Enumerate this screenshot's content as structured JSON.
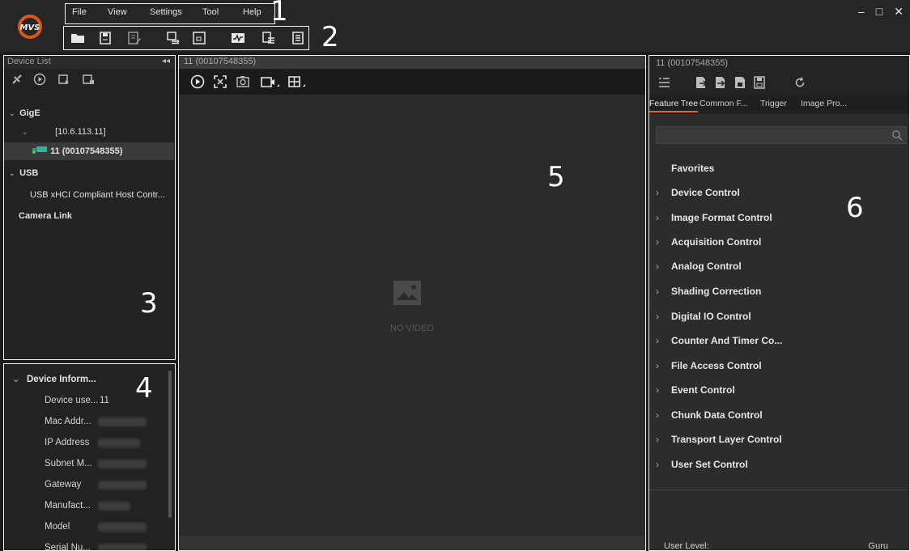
{
  "menu": [
    "File",
    "View",
    "Settings",
    "Tool",
    "Help"
  ],
  "window_controls": {
    "minimize": "–",
    "maximize": "□",
    "close": "✕"
  },
  "annotations": [
    "1",
    "2",
    "3",
    "4",
    "5",
    "6"
  ],
  "device_list": {
    "title": "Device List",
    "collapse": "◂◂",
    "tree": [
      {
        "label": "GigE",
        "level": 0,
        "bold": true,
        "expanded": true
      },
      {
        "label": "[10.6.113.11]",
        "level": 1,
        "bold": false,
        "expanded": true
      },
      {
        "label": "11 (00107548355)",
        "level": 2,
        "bold": true,
        "selected": true
      },
      {
        "label": "USB",
        "level": 0,
        "bold": true,
        "expanded": true
      },
      {
        "label": "USB xHCI Compliant Host Contr...",
        "level": 1,
        "bold": false
      },
      {
        "label": "Camera Link",
        "level": 0,
        "bold": true
      }
    ]
  },
  "device_info": {
    "section": "Device Inform...",
    "rows": [
      {
        "key": "Device use...",
        "value": "11"
      },
      {
        "key": "Mac Addr...",
        "value": ""
      },
      {
        "key": "IP Address",
        "value": ""
      },
      {
        "key": "Subnet M...",
        "value": ""
      },
      {
        "key": "Gateway",
        "value": ""
      },
      {
        "key": "Manufact...",
        "value": ""
      },
      {
        "key": "Model",
        "value": ""
      },
      {
        "key": "Serial Nu...",
        "value": ""
      }
    ]
  },
  "video": {
    "title": "11 (00107548355)",
    "no_video": "NO VIDEO"
  },
  "feature": {
    "title": "11 (00107548355)",
    "tabs": [
      "Feature Tree",
      "Common F...",
      "Trigger",
      "Image Pro..."
    ],
    "search_placeholder": "",
    "favorites": "Favorites",
    "items": [
      "Device Control",
      "Image Format Control",
      "Acquisition Control",
      "Analog Control",
      "Shading Correction",
      "Digital IO Control",
      "Counter And Timer Co...",
      "File Access Control",
      "Event Control",
      "Chunk Data Control",
      "Transport Layer Control",
      "User Set Control"
    ],
    "user_level_label": "User Level:",
    "user_level_value": "Guru"
  },
  "colors": {
    "accent": "#e0651a",
    "camera_icon": "#2fb5a0",
    "annotation_border": "#f0f0f0"
  }
}
